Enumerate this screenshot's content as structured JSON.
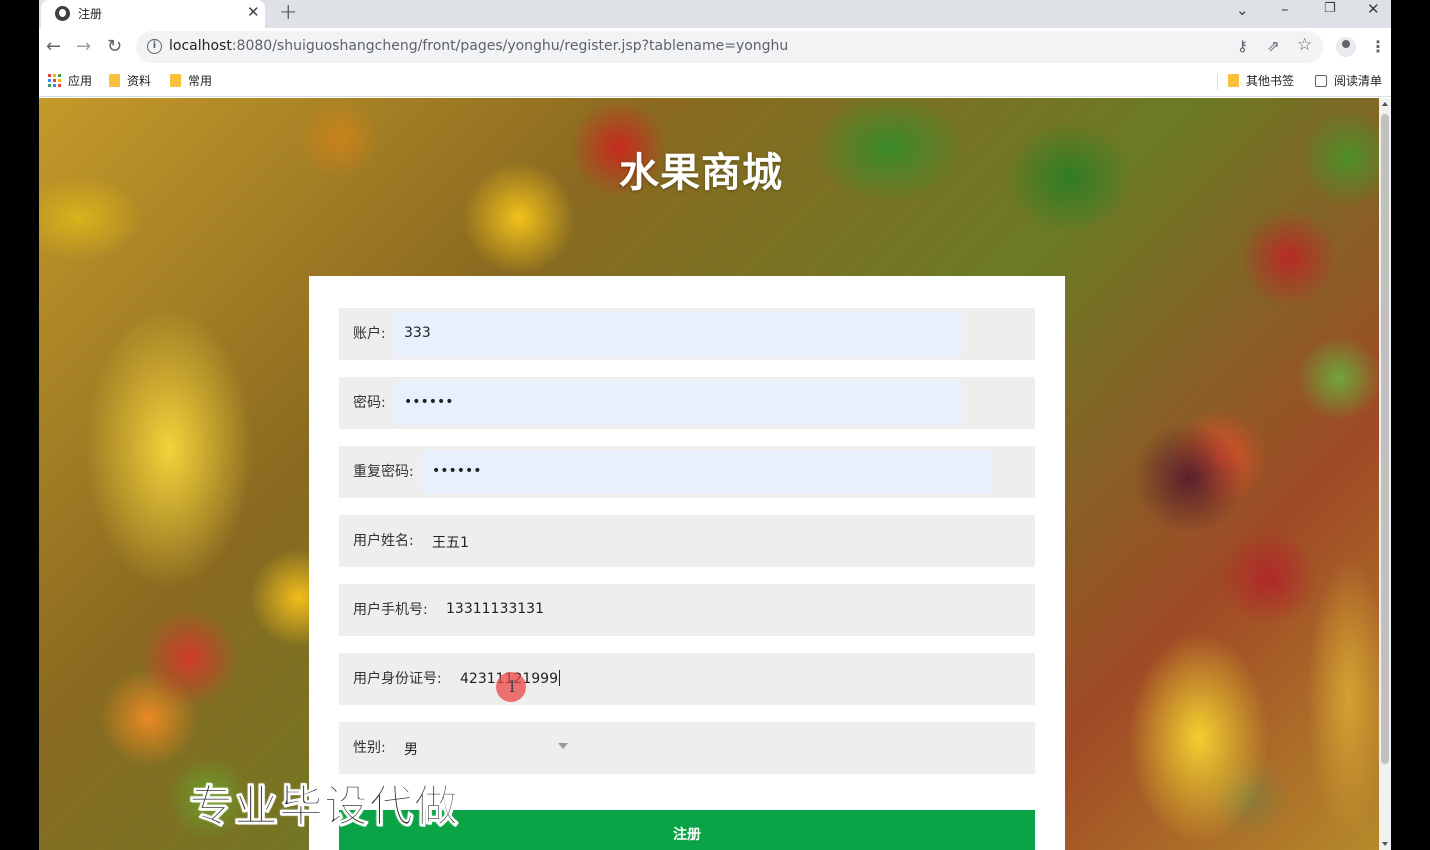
{
  "browser": {
    "tab_title": "注册",
    "tab_close_icon": "✕",
    "new_tab_icon": "+",
    "url_host": "localhost",
    "url_rest": ":8080/shuiguoshangcheng/front/pages/yonghu/register.jsp?tablename=yonghu",
    "nav": {
      "back": "←",
      "forward": "→",
      "reload": "↻"
    },
    "window_controls": {
      "tab_search": "⌄",
      "minimize": "–",
      "restore": "❐",
      "close": "✕"
    },
    "omnibox_icons": {
      "key": "⚷",
      "share": "⇗",
      "star": "☆"
    },
    "menu_icon": "⋮",
    "bookmarks": {
      "apps": "应用",
      "folders": [
        "资料",
        "常用"
      ],
      "other_bookmarks": "其他书签",
      "reading_list": "阅读清单"
    },
    "apps_grid_colors": [
      "#ea4335",
      "#fbbc05",
      "#34a853",
      "#4285f4",
      "#ea4335",
      "#fbbc05",
      "#34a853",
      "#4285f4",
      "#ea4335"
    ]
  },
  "page": {
    "site_title": "水果商城",
    "form": {
      "account": {
        "label": "账户:",
        "value": "333"
      },
      "password": {
        "label": "密码:",
        "value": "••••••"
      },
      "repeat_password": {
        "label": "重复密码:",
        "value": "••••••"
      },
      "user_name": {
        "label": "用户姓名:",
        "value": "王五1"
      },
      "phone": {
        "label": "用户手机号:",
        "value": "13311133131"
      },
      "id_card": {
        "label": "用户身份证号:",
        "value": "42311121999"
      },
      "gender": {
        "label": "性别:",
        "value": "男"
      },
      "submit_label": "注册"
    },
    "watermark": "专业毕设代做"
  },
  "colors": {
    "submit_green": "#0aa346",
    "autofill_blue": "#e8f0fe",
    "field_bg": "#eeeeee"
  }
}
